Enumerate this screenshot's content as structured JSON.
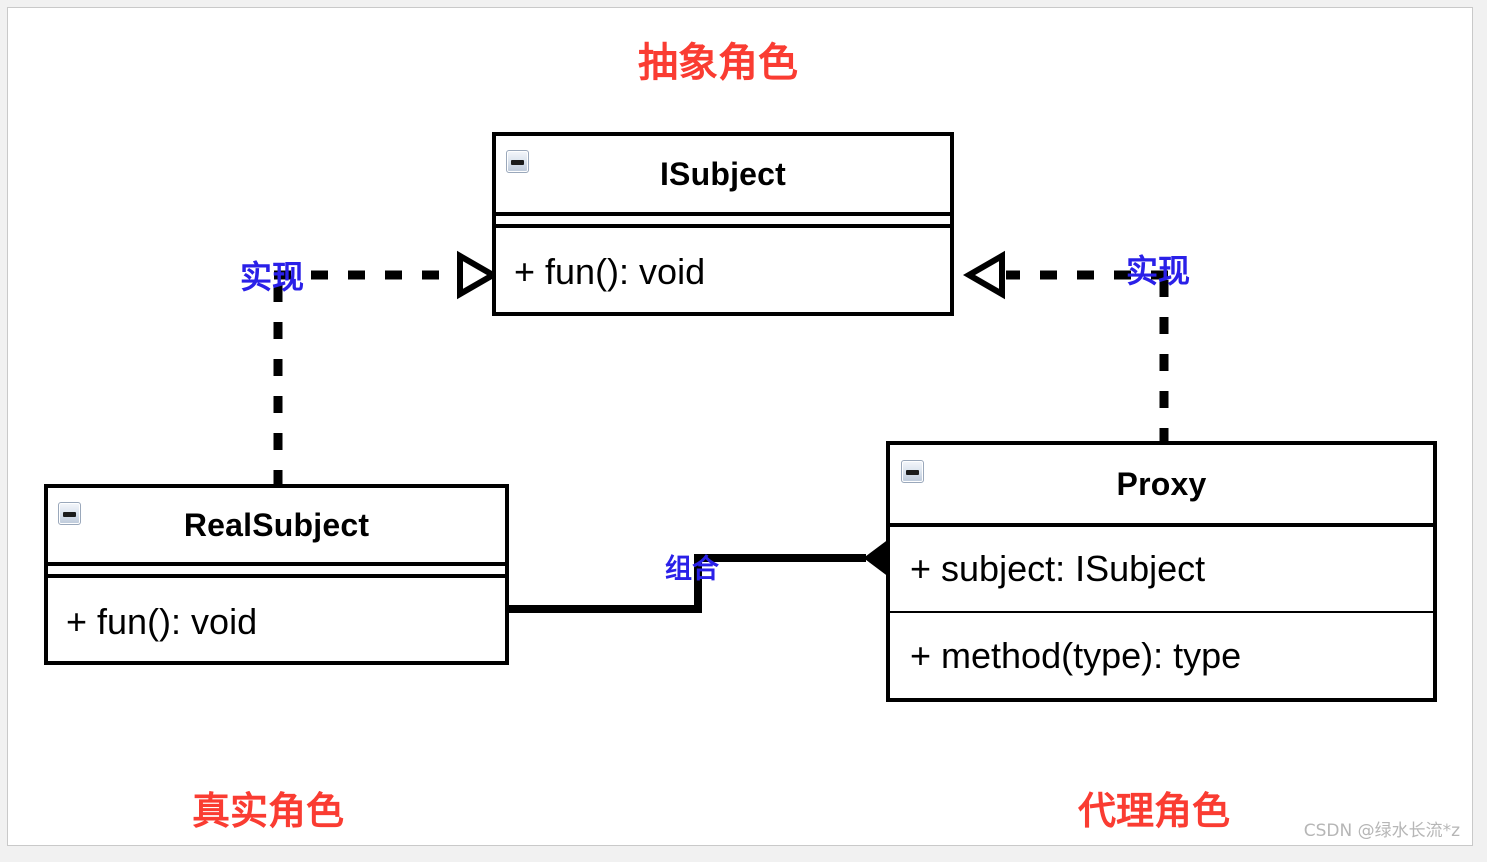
{
  "diagram": {
    "kind": "uml-class-diagram",
    "pattern": "Proxy Pattern",
    "colors": {
      "line": "#000000",
      "annotation_red": "#fa3c32",
      "annotation_blue": "#2a20e8",
      "box_fill": "#ffffff",
      "canvas": "#ffffff",
      "frame": "#c9c9c9",
      "watermark": "#b6b6b6"
    }
  },
  "annotations": {
    "abstract_role": "抽象角色",
    "real_role": "真实角色",
    "proxy_role": "代理角色",
    "realize_left": "实现",
    "realize_right": "实现",
    "composition": "组合"
  },
  "classes": {
    "isubject": {
      "name": "ISubject",
      "collapse_icon": "collapse-minus-icon",
      "attributes": [],
      "operations": [
        "+ fun(): void"
      ]
    },
    "realsubject": {
      "name": "RealSubject",
      "collapse_icon": "collapse-minus-icon",
      "attributes": [],
      "operations": [
        "+ fun(): void"
      ]
    },
    "proxy": {
      "name": "Proxy",
      "collapse_icon": "collapse-minus-icon",
      "attributes": [
        "+ subject: ISubject"
      ],
      "operations": [
        "+ method(type): type"
      ]
    }
  },
  "relationships": [
    {
      "id": "realize-realsubject-isubject",
      "type": "realization",
      "from": "RealSubject",
      "to": "ISubject",
      "label": "实现",
      "line_style": "dashed",
      "arrow": "hollow-triangle"
    },
    {
      "id": "realize-proxy-isubject",
      "type": "realization",
      "from": "Proxy",
      "to": "ISubject",
      "label": "实现",
      "line_style": "dashed",
      "arrow": "hollow-triangle"
    },
    {
      "id": "composition-proxy-realsubject",
      "type": "composition",
      "from": "Proxy",
      "to": "RealSubject",
      "label": "组合",
      "line_style": "solid",
      "arrow": "filled-diamond"
    }
  ],
  "watermark": {
    "text": "CSDN @绿水长流*z"
  }
}
